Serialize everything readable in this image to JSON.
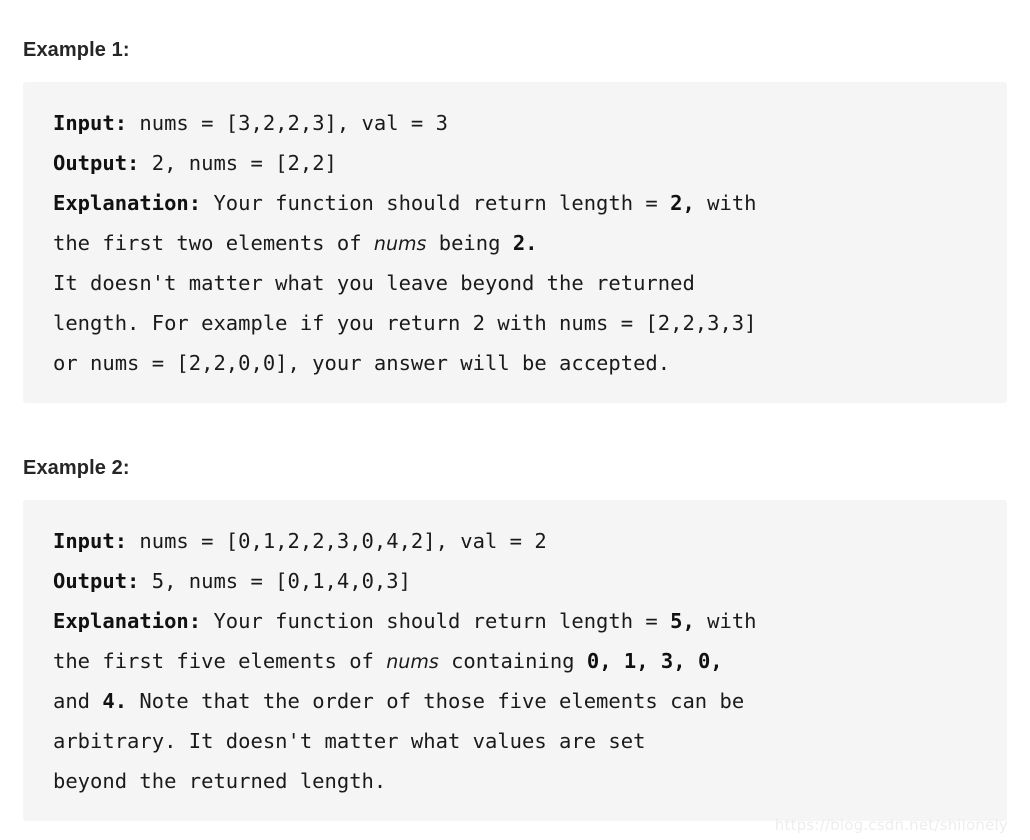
{
  "examples": [
    {
      "heading": "Example 1:",
      "lines": [
        [
          {
            "t": "Input:",
            "s": "kw"
          },
          {
            "t": " nums = [3,2,2,3], val = 3",
            "s": "n"
          }
        ],
        [
          {
            "t": "Output:",
            "s": "kw"
          },
          {
            "t": " 2, nums = [2,2]",
            "s": "n"
          }
        ],
        [
          {
            "t": "Explanation:",
            "s": "kw"
          },
          {
            "t": " Your function should return length = ",
            "s": "n"
          },
          {
            "t": "2,",
            "s": "b"
          },
          {
            "t": " with",
            "s": "n"
          }
        ],
        [
          {
            "t": "the first two elements of ",
            "s": "n"
          },
          {
            "t": "nums",
            "s": "it"
          },
          {
            "t": " being ",
            "s": "n"
          },
          {
            "t": "2.",
            "s": "b"
          }
        ],
        [
          {
            "t": "It doesn't matter what you leave beyond the returned",
            "s": "n"
          }
        ],
        [
          {
            "t": "length. For example if you return 2 with nums = [2,2,3,3]",
            "s": "n"
          }
        ],
        [
          {
            "t": "or nums = [2,2,0,0], your answer will be accepted.",
            "s": "n"
          }
        ]
      ]
    },
    {
      "heading": "Example 2:",
      "lines": [
        [
          {
            "t": "Input:",
            "s": "kw"
          },
          {
            "t": " nums = [0,1,2,2,3,0,4,2], val = 2",
            "s": "n"
          }
        ],
        [
          {
            "t": "Output:",
            "s": "kw"
          },
          {
            "t": " 5, nums = [0,1,4,0,3]",
            "s": "n"
          }
        ],
        [
          {
            "t": "Explanation:",
            "s": "kw"
          },
          {
            "t": " Your function should return length = ",
            "s": "n"
          },
          {
            "t": "5,",
            "s": "b"
          },
          {
            "t": " with",
            "s": "n"
          }
        ],
        [
          {
            "t": "the first five elements of ",
            "s": "n"
          },
          {
            "t": "nums",
            "s": "it"
          },
          {
            "t": " containing ",
            "s": "n"
          },
          {
            "t": "0, 1, 3, 0,",
            "s": "b"
          }
        ],
        [
          {
            "t": "and ",
            "s": "n"
          },
          {
            "t": "4.",
            "s": "b"
          },
          {
            "t": " Note that the order of those five elements can be",
            "s": "n"
          }
        ],
        [
          {
            "t": "arbitrary. It doesn't matter what values are set",
            "s": "n"
          }
        ],
        [
          {
            "t": "beyond the returned length.",
            "s": "n"
          }
        ]
      ]
    }
  ],
  "watermark": {
    "text": "https://blog.csdn.net/shilonely"
  },
  "colors": {
    "code_background": "#f5f5f5",
    "text": "#1a1a1a",
    "heading": "#262626",
    "watermark": "#ededed"
  }
}
